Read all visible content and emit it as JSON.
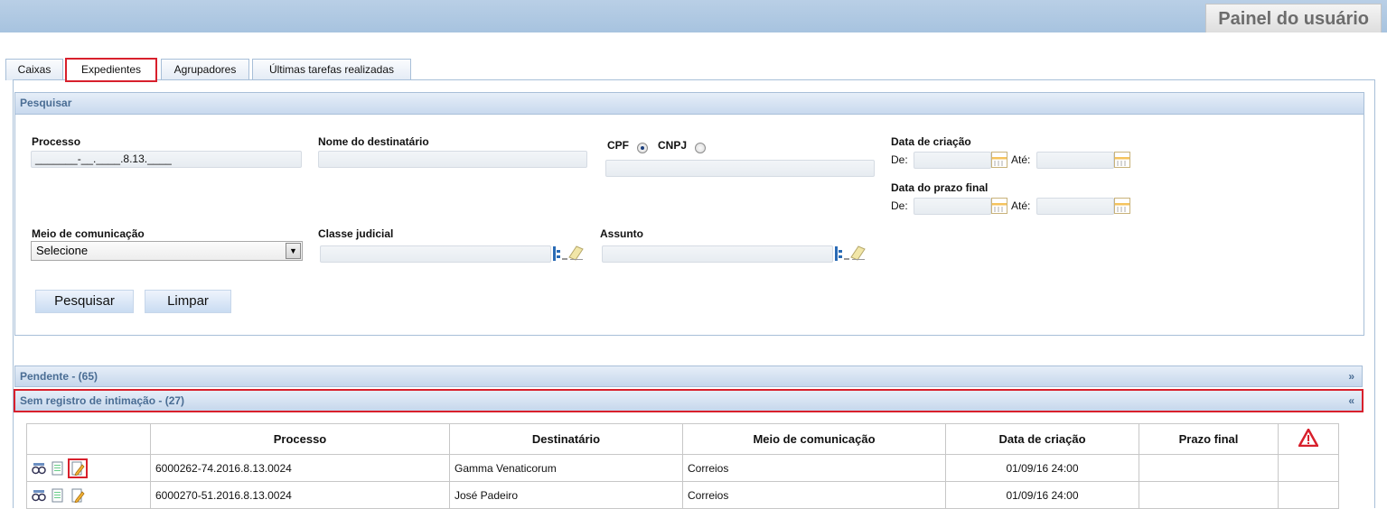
{
  "header": {
    "panel_title": "Painel do usuário"
  },
  "tabs": [
    {
      "label": "Caixas",
      "active": false
    },
    {
      "label": "Expedientes",
      "active": true
    },
    {
      "label": "Agrupadores",
      "active": false
    },
    {
      "label": "Últimas tarefas realizadas",
      "active": false
    }
  ],
  "search": {
    "title": "Pesquisar",
    "processo_label": "Processo",
    "processo_value": "_______-__.____.8.13.____",
    "destinatario_label": "Nome do destinatário",
    "destinatario_value": "",
    "cpf_label": "CPF",
    "cnpj_label": "CNPJ",
    "doc_selected": "CPF",
    "doc_value": "",
    "data_criacao_label": "Data de criação",
    "data_prazo_label": "Data do prazo final",
    "de_label": "De:",
    "ate_label": "Até:",
    "meio_label": "Meio de comunicação",
    "meio_value": "Selecione",
    "classe_label": "Classe judicial",
    "assunto_label": "Assunto",
    "btn_pesquisar": "Pesquisar",
    "btn_limpar": "Limpar"
  },
  "sections": {
    "pendente": {
      "label": "Pendente - (65)",
      "chevron": "»"
    },
    "sem_registro": {
      "label": "Sem registro de intimação - (27)",
      "chevron": "«"
    }
  },
  "table": {
    "columns": [
      "",
      "Processo",
      "Destinatário",
      "Meio de comunicação",
      "Data de criação",
      "Prazo final",
      "alert-icon"
    ],
    "rows": [
      {
        "processo": "6000262-74.2016.8.13.0024",
        "destinatario": "Gamma Venaticorum",
        "meio": "Correios",
        "data_criacao": "01/09/16 24:00",
        "prazo_final": ""
      },
      {
        "processo": "6000270-51.2016.8.13.0024",
        "destinatario": "José Padeiro",
        "meio": "Correios",
        "data_criacao": "01/09/16 24:00",
        "prazo_final": ""
      }
    ]
  },
  "colors": {
    "accent_blue": "#4a6d94",
    "topbar": "#a7c3df",
    "highlight_red": "#d8202c"
  }
}
